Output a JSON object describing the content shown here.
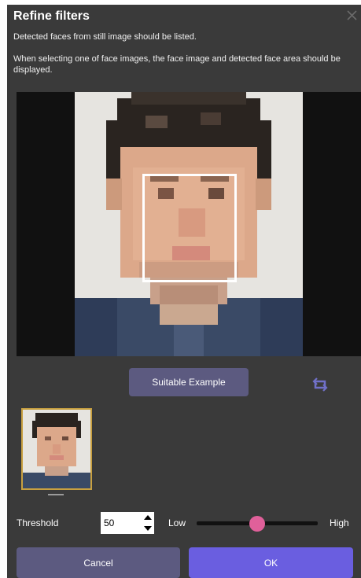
{
  "dialog": {
    "title": "Refine filters",
    "description_1": "Detected faces from still image should be listed.",
    "description_2": "When selecting one of face images, the face image and detected face area should be displayed."
  },
  "preview": {
    "image_icon": "pixelated-face-photo",
    "face_box_color": "#ffffff"
  },
  "actions": {
    "suitable_example_label": "Suitable Example",
    "rotate_icon": "rotate-icon"
  },
  "thumbnails": [
    {
      "icon": "face-thumbnail",
      "selected": true
    }
  ],
  "threshold": {
    "label": "Threshold",
    "value": "50",
    "low_label": "Low",
    "high_label": "High",
    "slider_level": 0.5
  },
  "footer": {
    "cancel_label": "Cancel",
    "ok_label": "OK"
  },
  "colors": {
    "dialog_bg": "#3a3a3a",
    "secondary_button": "#5c5a80",
    "primary_button": "#6a5ee0",
    "slider_thumb": "#e0609a",
    "thumbnail_border": "#c8a040"
  }
}
